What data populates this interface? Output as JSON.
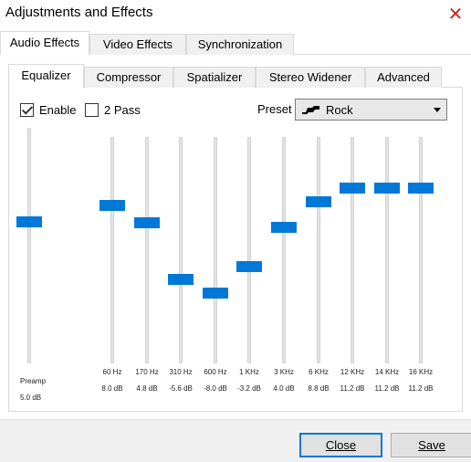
{
  "window": {
    "title": "Adjustments and Effects",
    "close_glyph": "✕"
  },
  "outer_tabs": [
    "Audio Effects",
    "Video Effects",
    "Synchronization"
  ],
  "inner_tabs": [
    "Equalizer",
    "Compressor",
    "Spatializer",
    "Stereo Widener",
    "Advanced"
  ],
  "options": {
    "enable_label": "Enable",
    "enable_checked": true,
    "two_pass_label": "2 Pass",
    "two_pass_checked": false
  },
  "preset": {
    "label": "Preset",
    "value": "Rock",
    "icon": "rock-preset-icon"
  },
  "preamp": {
    "label": "Preamp",
    "value": "5.0 dB",
    "level_db": 5.0
  },
  "bands": [
    {
      "freq": "60 Hz",
      "gain": "8.0 dB",
      "db": 8.0
    },
    {
      "freq": "170 Hz",
      "gain": "4.8 dB",
      "db": 4.8
    },
    {
      "freq": "310 Hz",
      "gain": "-5.6 dB",
      "db": -5.6
    },
    {
      "freq": "600 Hz",
      "gain": "-8.0 dB",
      "db": -8.0
    },
    {
      "freq": "1 KHz",
      "gain": "-3.2 dB",
      "db": -3.2
    },
    {
      "freq": "3 KHz",
      "gain": "4.0 dB",
      "db": 4.0
    },
    {
      "freq": "6 KHz",
      "gain": "8.8 dB",
      "db": 8.8
    },
    {
      "freq": "12 KHz",
      "gain": "11.2 dB",
      "db": 11.2
    },
    {
      "freq": "14 KHz",
      "gain": "11.2 dB",
      "db": 11.2
    },
    {
      "freq": "16 KHz",
      "gain": "11.2 dB",
      "db": 11.2
    }
  ],
  "buttons": {
    "close": "Close",
    "save": "Save"
  },
  "colors": {
    "accent": "#0078d7",
    "close_red": "#c42b1c"
  }
}
